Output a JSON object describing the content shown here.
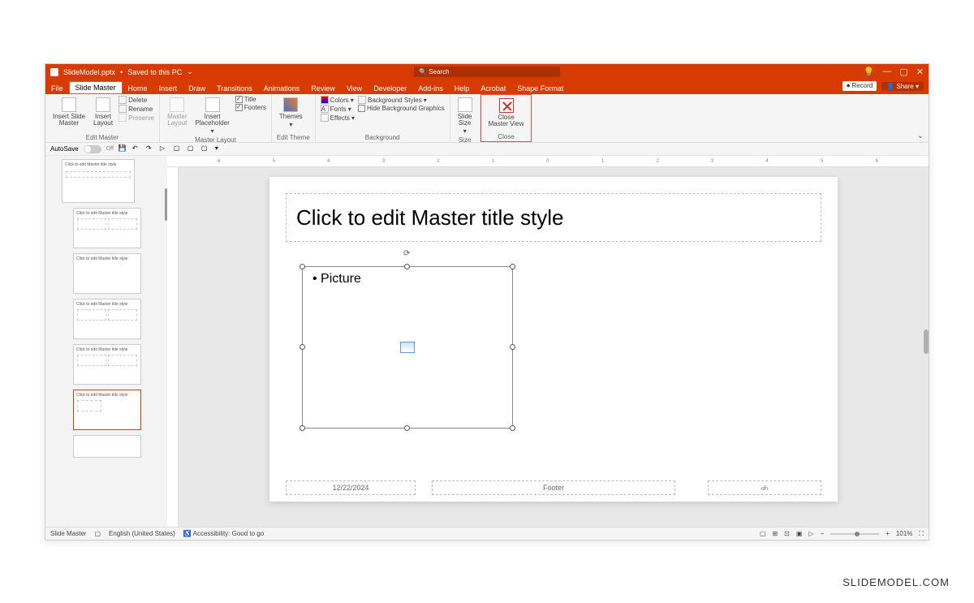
{
  "titlebar": {
    "filename": "SlideModel.pptx",
    "save_status": "Saved to this PC",
    "search_placeholder": "Search"
  },
  "window_controls": {
    "min": "—",
    "max": "▢",
    "close": "✕"
  },
  "tabs": {
    "file": "File",
    "slide_master": "Slide Master",
    "home": "Home",
    "insert": "Insert",
    "draw": "Draw",
    "transitions": "Transitions",
    "animations": "Animations",
    "review": "Review",
    "view": "View",
    "developer": "Developer",
    "addins": "Add-ins",
    "help": "Help",
    "acrobat": "Acrobat",
    "shape_format": "Shape Format",
    "record": "Record",
    "share": "Share"
  },
  "ribbon": {
    "edit_master": {
      "insert_slide_master": "Insert Slide\nMaster",
      "insert_layout": "Insert\nLayout",
      "delete": "Delete",
      "rename": "Rename",
      "preserve": "Preserve",
      "label": "Edit Master"
    },
    "master_layout": {
      "master_layout": "Master\nLayout",
      "insert_placeholder": "Insert\nPlaceholder",
      "title": "Title",
      "footers": "Footers",
      "label": "Master Layout"
    },
    "edit_theme": {
      "themes": "Themes",
      "label": "Edit Theme"
    },
    "background": {
      "colors": "Colors",
      "fonts": "Fonts",
      "effects": "Effects",
      "bg_styles": "Background Styles",
      "hide_bg": "Hide Background Graphics",
      "label": "Background"
    },
    "size": {
      "slide_size": "Slide\nSize",
      "label": "Size"
    },
    "close": {
      "close_master_view": "Close\nMaster View",
      "label": "Close"
    }
  },
  "qat": {
    "autosave": "AutoSave",
    "off": "Off"
  },
  "slide": {
    "title": "Click to edit Master title style",
    "picture": "Picture",
    "date": "12/22/2024",
    "footer": "Footer"
  },
  "thumb_text": "Click to edit Master title style",
  "ruler_marks": [
    "6",
    "5",
    "4",
    "3",
    "2",
    "1",
    "0",
    "1",
    "2",
    "3",
    "4",
    "5",
    "6"
  ],
  "status": {
    "mode": "Slide Master",
    "language": "English (United States)",
    "accessibility": "Accessibility: Good to go",
    "zoom": "101%"
  },
  "watermark": "SLIDEMODEL.COM"
}
